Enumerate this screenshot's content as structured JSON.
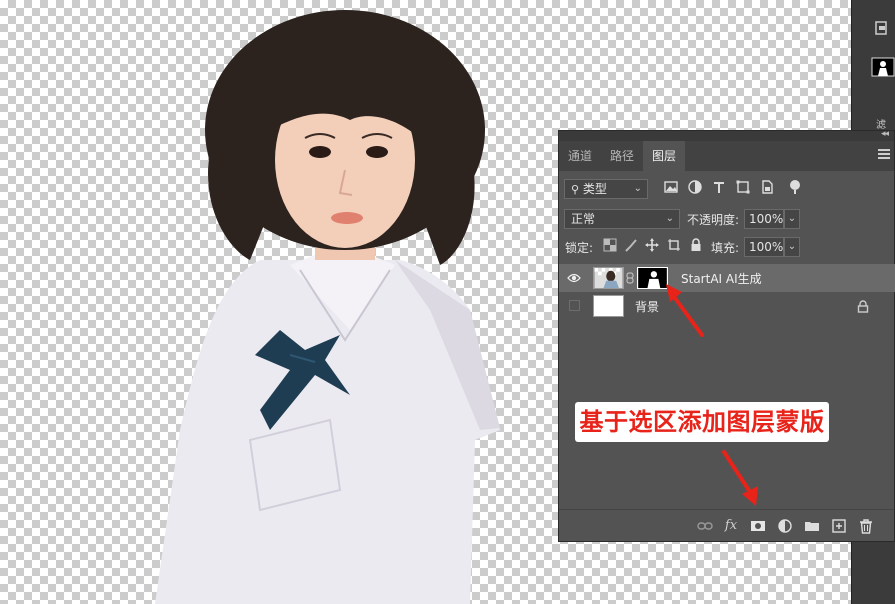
{
  "panel": {
    "tabs": [
      {
        "label": "通道",
        "active": false
      },
      {
        "label": "路径",
        "active": false
      },
      {
        "label": "图层",
        "active": true
      }
    ],
    "filter_type": "类型",
    "filter_icons": [
      "image-filter-icon",
      "adjustment-filter-icon",
      "type-filter-icon",
      "shape-filter-icon",
      "smart-object-filter-icon",
      "filter-toggle-icon"
    ],
    "blend_mode": "正常",
    "opacity_label": "不透明度:",
    "opacity_value": "100%",
    "lock_label": "锁定:",
    "lock_icons": [
      "lock-transparent-pixels-icon",
      "lock-image-pixels-icon",
      "lock-position-icon",
      "lock-artboard-icon",
      "lock-all-icon"
    ],
    "fill_label": "填充:",
    "fill_value": "100%",
    "layers": [
      {
        "name": "StartAI AI生成",
        "visible": true,
        "selected": true,
        "has_mask": true
      },
      {
        "name": "背景",
        "visible": false,
        "selected": false,
        "locked": true
      }
    ],
    "bottom_icons": [
      "link-layers-icon",
      "fx-icon",
      "add-mask-icon",
      "adjustment-layer-icon",
      "group-folder-icon",
      "new-layer-icon",
      "trash-icon"
    ],
    "fx_label": "fx"
  },
  "annotation": {
    "callout_text": "基于选区添加图层蒙版",
    "color": "#e8231a"
  },
  "dock": {
    "partial_text": "滤镜"
  }
}
